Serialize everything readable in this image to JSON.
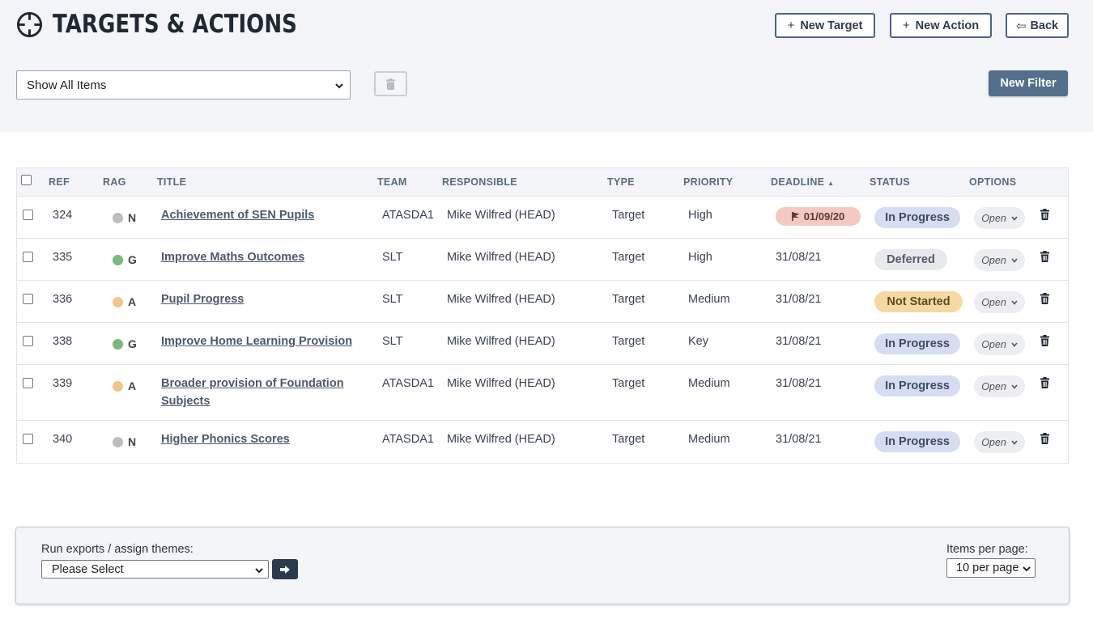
{
  "header": {
    "title": "TARGETS & ACTIONS",
    "new_target_label": "New Target",
    "new_action_label": "New Action",
    "back_label": "Back",
    "plus_glyph": "+",
    "back_glyph": "⇦"
  },
  "filter": {
    "selected": "Show All Items",
    "new_filter_label": "New Filter"
  },
  "table": {
    "columns": {
      "ref": "REF",
      "rag": "RAG",
      "title": "TITLE",
      "team": "TEAM",
      "responsible": "RESPONSIBLE",
      "type": "TYPE",
      "priority": "PRIORITY",
      "deadline": "DEADLINE",
      "status": "STATUS",
      "options": "OPTIONS"
    },
    "sort_indicator": "▲",
    "rows": [
      {
        "ref": "324",
        "rag": "N",
        "rag_color": "#bdbdbd",
        "title": "Achievement of SEN Pupils",
        "team": "ATASDA1",
        "responsible": "Mike Wilfred (HEAD)",
        "type": "Target",
        "priority": "High",
        "deadline": "01/09/20",
        "overdue": true,
        "status": "In Progress",
        "option": "Open"
      },
      {
        "ref": "335",
        "rag": "G",
        "rag_color": "#7ab87a",
        "title": "Improve Maths Outcomes",
        "team": "SLT",
        "responsible": "Mike Wilfred (HEAD)",
        "type": "Target",
        "priority": "High",
        "deadline": "31/08/21",
        "overdue": false,
        "status": "Deferred",
        "option": "Open"
      },
      {
        "ref": "336",
        "rag": "A",
        "rag_color": "#efc58d",
        "title": "Pupil Progress",
        "team": "SLT",
        "responsible": "Mike Wilfred (HEAD)",
        "type": "Target",
        "priority": "Medium",
        "deadline": "31/08/21",
        "overdue": false,
        "status": "Not Started",
        "option": "Open"
      },
      {
        "ref": "338",
        "rag": "G",
        "rag_color": "#7ab87a",
        "title": "Improve Home Learning Provision",
        "team": "SLT",
        "responsible": "Mike Wilfred (HEAD)",
        "type": "Target",
        "priority": "Key",
        "deadline": "31/08/21",
        "overdue": false,
        "status": "In Progress",
        "option": "Open"
      },
      {
        "ref": "339",
        "rag": "A",
        "rag_color": "#efc58d",
        "title": "Broader provision of Foundation Subjects",
        "team": "ATASDA1",
        "responsible": "Mike Wilfred (HEAD)",
        "type": "Target",
        "priority": "Medium",
        "deadline": "31/08/21",
        "overdue": false,
        "status": "In Progress",
        "option": "Open"
      },
      {
        "ref": "340",
        "rag": "N",
        "rag_color": "#bdbdbd",
        "title": "Higher Phonics Scores",
        "team": "ATASDA1",
        "responsible": "Mike Wilfred (HEAD)",
        "type": "Target",
        "priority": "Medium",
        "deadline": "31/08/21",
        "overdue": false,
        "status": "In Progress",
        "option": "Open"
      }
    ]
  },
  "footer": {
    "export_label": "Run exports / assign themes:",
    "export_selected": "Please Select",
    "items_per_page_label": "Items per page:",
    "items_per_page_selected": "10 per page"
  },
  "colors": {
    "accent": "#546f8c",
    "panel_bg": "#f4f5f8",
    "in_progress": "#d6dcf3",
    "deferred": "#e8e9ec",
    "not_started": "#f5d9a0",
    "overdue": "#f3c9c1"
  }
}
